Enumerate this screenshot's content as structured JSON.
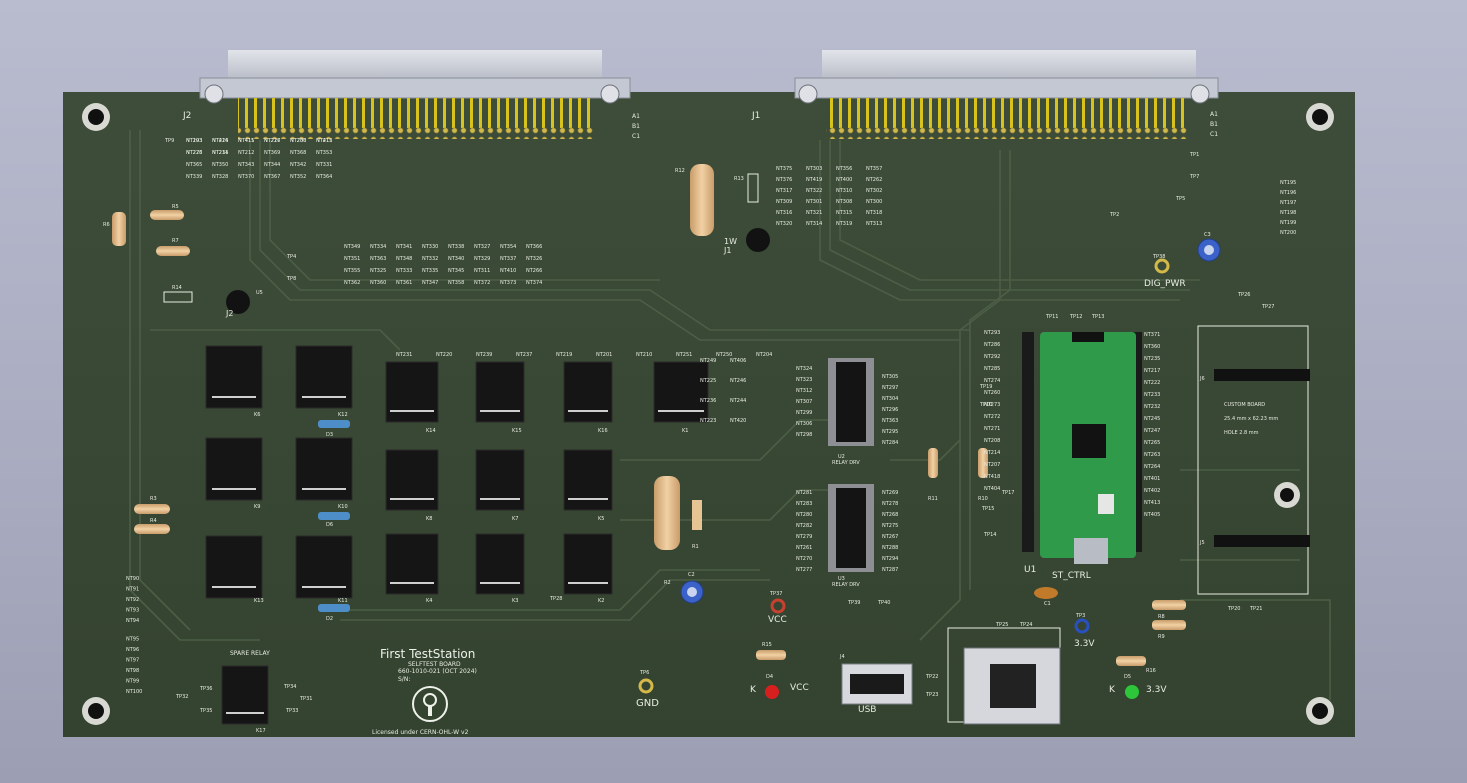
{
  "board": {
    "title": "First TestStation",
    "subtitle": "SELFTEST BOARD",
    "part_number": "660-1010-021  (OCT 2024)",
    "serial_label": "S/N:",
    "license": "Licensed under CERN-OHL-W v2",
    "colors": {
      "background": "#aeb0c4",
      "pcb": "#3a4a36",
      "silkscreen": "#e8ece3",
      "copper_pad": "#d4b84a",
      "pico": "#2f9a4a"
    }
  },
  "connectors": {
    "j2": "J2",
    "j1": "J1",
    "rows": [
      "A1",
      "B1",
      "C1"
    ]
  },
  "relays": {
    "k_labels": [
      "K6",
      "K12",
      "K9",
      "K10",
      "K13",
      "K11",
      "K14",
      "K15",
      "K16",
      "K1",
      "K8",
      "K7",
      "K5",
      "K4",
      "K3",
      "K2"
    ],
    "spare_title": "SPARE RELAY",
    "spare_ref": "K17"
  },
  "ics": {
    "u2": "U2",
    "u3": "U3",
    "u2_caption": "RELAY DRV",
    "u3_caption": "RELAY DRV",
    "u1": "U1",
    "u1_caption": "ST_CTRL"
  },
  "custom_board": {
    "title": "CUSTOM BOARD",
    "size": "25.4 mm x 62.23 mm",
    "hole": "HOLE 2.8 mm",
    "j5": "J5",
    "j6": "J6"
  },
  "labels": {
    "dig_pwr": "DIG_PWR",
    "vcc_top": "VCC",
    "vcc_led": "VCC",
    "gnd": "GND",
    "v33_tp": "3.3V",
    "v33_led": "3.3V",
    "usb": "USB",
    "j4": "J4",
    "d4": "D4",
    "d5": "D5",
    "k_d4": "K",
    "k_d5": "K",
    "tp37": "TP37",
    "tp6": "TP6",
    "tp3": "TP3",
    "tp38": "TP38",
    "one_w": "1W",
    "j1_small": "J1",
    "j2_small": "J2",
    "u5": "U5"
  },
  "resistors": [
    "R12",
    "R13",
    "R6",
    "R5",
    "R7",
    "R14",
    "R2",
    "R1",
    "R3",
    "R4",
    "R11",
    "R10",
    "R15",
    "R8",
    "R9",
    "R16"
  ],
  "capacitors": [
    "C2",
    "C3",
    "C1"
  ],
  "diodes": [
    "D3",
    "D6",
    "D2"
  ],
  "nets_left": [
    "NT90",
    "NT91",
    "NT92",
    "NT93",
    "NT94",
    "NT95",
    "NT96",
    "NT97",
    "NT98",
    "NT99",
    "NT100"
  ],
  "nets_right": [
    "NT195",
    "NT196",
    "NT197",
    "NT198",
    "NT199",
    "NT200"
  ],
  "testpoints": [
    "TP9",
    "TP4",
    "TP8",
    "TP1",
    "TP7",
    "TP5",
    "TP2",
    "TP26",
    "TP27",
    "TP11",
    "TP12",
    "TP13",
    "TP19",
    "TP10",
    "TP17",
    "TP15",
    "TP14",
    "TP28",
    "TP39",
    "TP40",
    "TP22",
    "TP23",
    "TP25",
    "TP24",
    "TP20",
    "TP21",
    "TP36",
    "TP34",
    "TP31",
    "TP32",
    "TP35",
    "TP33"
  ],
  "small_nets": [
    "NT193",
    "NT226",
    "NT411",
    "NT227",
    "NT230",
    "NT412",
    "NT228",
    "NT211",
    "NT212",
    "NT369",
    "NT368",
    "NT353",
    "NT365",
    "NT350",
    "NT343",
    "NT344",
    "NT342",
    "NT331",
    "NT339",
    "NT328",
    "NT370",
    "NT367",
    "NT352",
    "NT364",
    "NT349",
    "NT334",
    "NT341",
    "NT330",
    "NT338",
    "NT327",
    "NT354",
    "NT366",
    "NT351",
    "NT363",
    "NT348",
    "NT332",
    "NT340",
    "NT329",
    "NT337",
    "NT326",
    "NT355",
    "NT325",
    "NT333",
    "NT335",
    "NT345",
    "NT311",
    "NT410",
    "NT266",
    "NT362",
    "NT360",
    "NT361",
    "NT347",
    "NT358",
    "NT372",
    "NT373",
    "NT374",
    "NT375",
    "NT303",
    "NT356",
    "NT357",
    "NT376",
    "NT419",
    "NT400",
    "NT262",
    "NT317",
    "NT322",
    "NT310",
    "NT302",
    "NT309",
    "NT301",
    "NT308",
    "NT300",
    "NT316",
    "NT321",
    "NT315",
    "NT318",
    "NT320",
    "NT314",
    "NT319",
    "NT313",
    "NT324",
    "NT323",
    "NT312",
    "NT307",
    "NT299",
    "NT306",
    "NT298",
    "NT305",
    "NT297",
    "NT304",
    "NT296",
    "NT363",
    "NT295",
    "NT284",
    "NT281",
    "NT283",
    "NT280",
    "NT282",
    "NT279",
    "NT261",
    "NT270",
    "NT277",
    "NT269",
    "NT278",
    "NT268",
    "NT275",
    "NT267",
    "NT288",
    "NT294",
    "NT287",
    "NT293",
    "NT286",
    "NT292",
    "NT285",
    "NT274",
    "NT260",
    "NT273",
    "NT272",
    "NT271",
    "NT208",
    "NT214",
    "NT207",
    "NT418",
    "NT404",
    "NT371",
    "NT360",
    "NT235",
    "NT217",
    "NT222",
    "NT233",
    "NT232",
    "NT245",
    "NT247",
    "NT265",
    "NT263",
    "NT264",
    "NT401",
    "NT402",
    "NT413",
    "NT405",
    "NT249",
    "NT406",
    "NT225",
    "NT246",
    "NT236",
    "NT244",
    "NT223",
    "NT420",
    "NT231",
    "NT220",
    "NT239",
    "NT237",
    "NT219",
    "NT201",
    "NT210",
    "NT251",
    "NT250",
    "NT204",
    "NT203",
    "NT414",
    "NT415",
    "NT216",
    "NT206",
    "NT215",
    "NT276",
    "NT234"
  ]
}
